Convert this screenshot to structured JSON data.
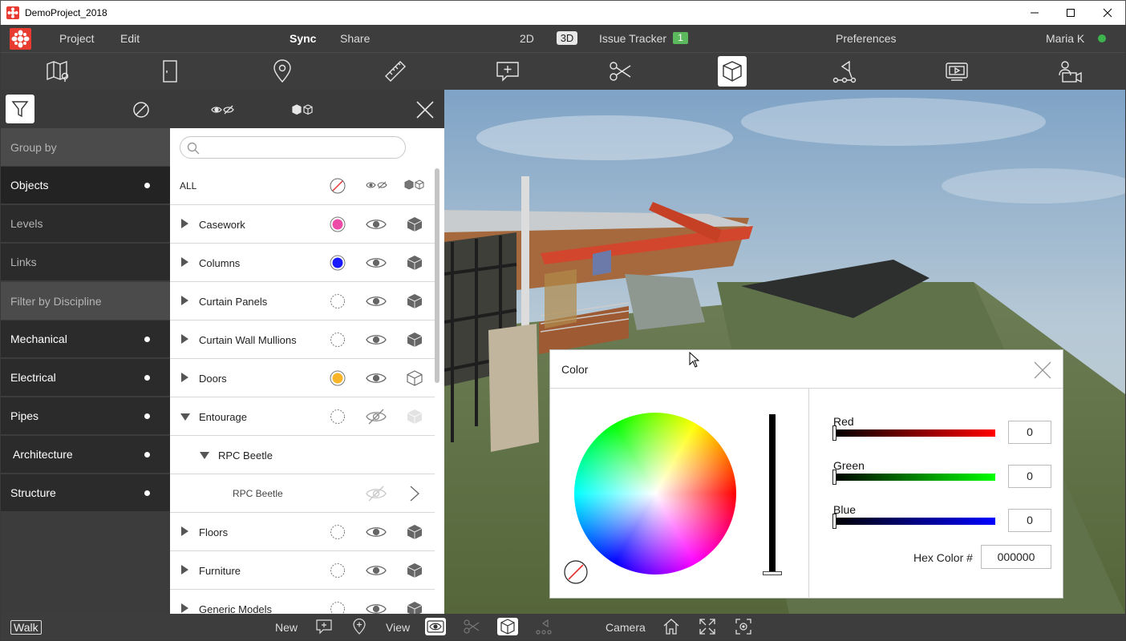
{
  "window": {
    "title": "DemoProject_2018"
  },
  "menu": {
    "project": "Project",
    "edit": "Edit",
    "sync": "Sync",
    "share": "Share",
    "view_2d": "2D",
    "view_3d": "3D",
    "issue_tracker": "Issue Tracker",
    "issue_count": "1",
    "preferences": "Preferences",
    "user": "Maria K"
  },
  "toolbar": {
    "active": "3d-view",
    "tools": [
      "sheets",
      "section-box",
      "location",
      "measure",
      "markup",
      "cutting-plane",
      "3d-view",
      "path",
      "presentation",
      "camera-settings"
    ]
  },
  "nav": {
    "group_by": "Group by",
    "groups": [
      {
        "label": "Objects",
        "selected": true
      },
      {
        "label": "Levels"
      },
      {
        "label": "Links"
      }
    ],
    "filter_heading": "Filter by Discipline",
    "disciplines": [
      {
        "label": "Mechanical"
      },
      {
        "label": "Electrical"
      },
      {
        "label": "Pipes"
      },
      {
        "label": "Architecture"
      },
      {
        "label": "Structure"
      }
    ]
  },
  "list": {
    "search_placeholder": "",
    "all_label": "ALL",
    "rows": [
      {
        "label": "Casework",
        "color": "#ec4ba8",
        "visible": true
      },
      {
        "label": "Columns",
        "color": "#1a1aff",
        "visible": true
      },
      {
        "label": "Curtain Panels",
        "color": null,
        "visible": true
      },
      {
        "label": "Curtain Wall Mullions",
        "color": null,
        "visible": true
      },
      {
        "label": "Doors",
        "color": "#f9b52a",
        "visible": true
      },
      {
        "label": "Entourage",
        "color": null,
        "visible": false,
        "expanded": true
      },
      {
        "label": "RPC Beetle",
        "sublevel": 1,
        "expanded": true
      },
      {
        "label": "RPC Beetle",
        "sublevel": 2
      },
      {
        "label": "Floors",
        "color": null,
        "visible": true
      },
      {
        "label": "Furniture",
        "color": null,
        "visible": true
      },
      {
        "label": "Generic Models",
        "color": null,
        "visible": true
      }
    ]
  },
  "bottom": {
    "walk": "Walk",
    "new": "New",
    "view": "View",
    "camera": "Camera"
  },
  "color_dialog": {
    "title": "Color",
    "red_label": "Red",
    "red_value": "0",
    "green_label": "Green",
    "green_value": "0",
    "blue_label": "Blue",
    "blue_value": "0",
    "hex_label": "Hex Color #",
    "hex_value": "000000"
  }
}
